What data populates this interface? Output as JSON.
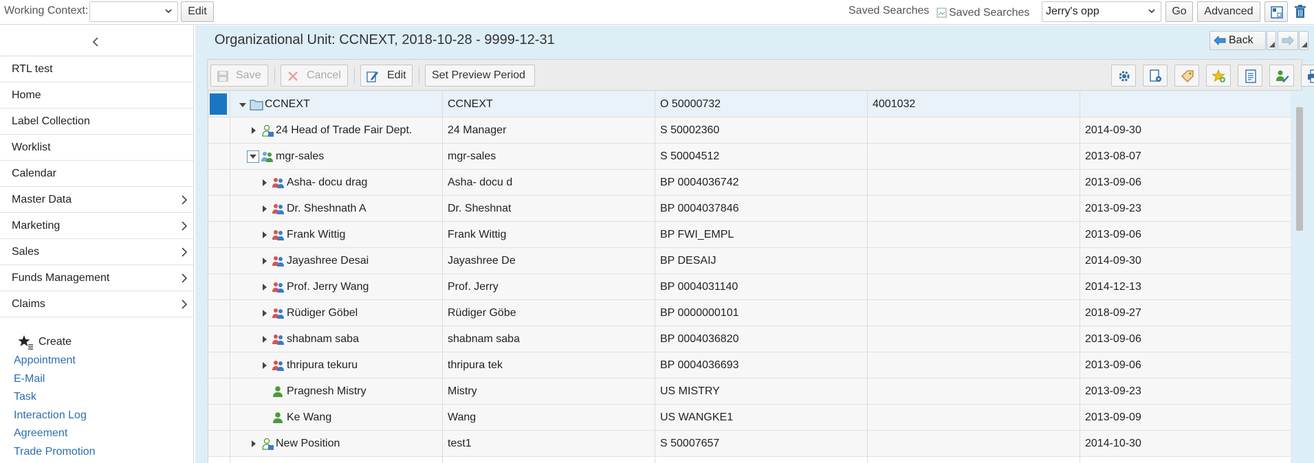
{
  "topbar": {
    "working_context_label": "Working Context:",
    "working_context_value": "",
    "edit_label": "Edit",
    "saved_searches_label": "Saved Searches",
    "saved_searches_img_alt": "Saved Searches",
    "saved_search_value": "Jerry's opp",
    "go_label": "Go",
    "advanced_label": "Advanced"
  },
  "sidebar": {
    "items": [
      {
        "label": "RTL test",
        "arrow": false
      },
      {
        "label": "Home",
        "arrow": false
      },
      {
        "label": "Label Collection",
        "arrow": false
      },
      {
        "label": "Worklist",
        "arrow": false
      },
      {
        "label": "Calendar",
        "arrow": false
      },
      {
        "label": "Master Data",
        "arrow": true
      },
      {
        "label": "Marketing",
        "arrow": true
      },
      {
        "label": "Sales",
        "arrow": true
      },
      {
        "label": "Funds Management",
        "arrow": true
      },
      {
        "label": "Claims",
        "arrow": true
      }
    ],
    "create_label": "Create",
    "create_links": [
      "Appointment",
      "E-Mail",
      "Task",
      "Interaction Log",
      "Agreement",
      "Trade Promotion"
    ]
  },
  "main": {
    "title": "Organizational Unit: CCNEXT, 2018-10-28 - 9999-12-31",
    "back_label": "Back",
    "toolbar": {
      "save_label": "Save",
      "cancel_label": "Cancel",
      "edit_label": "Edit",
      "preview_label": "Set Preview Period"
    }
  },
  "table": {
    "rows": [
      {
        "c1": "CCNEXT",
        "c2": "CCNEXT",
        "c3": "O 50000732",
        "c4": "4001032",
        "c5": "",
        "level": 0,
        "icon": "folder",
        "expander": "open",
        "selected": true
      },
      {
        "c1": "24 Head of Trade Fair Dept.",
        "c2": "24 Manager",
        "c3": "S 50002360",
        "c4": "",
        "c5": "2014-09-30",
        "level": 1,
        "icon": "position",
        "expander": "closed"
      },
      {
        "c1": "mgr-sales",
        "c2": "mgr-sales",
        "c3": "S 50004512",
        "c4": "",
        "c5": "2013-08-07",
        "level": 1,
        "icon": "position-group",
        "expander": "boxed-open"
      },
      {
        "c1": "Asha- docu drag",
        "c2": "Asha- docu d",
        "c3": "BP 0004036742",
        "c4": "",
        "c5": "2013-09-06",
        "level": 2,
        "icon": "people",
        "expander": "closed"
      },
      {
        "c1": "Dr. Sheshnath A",
        "c2": "Dr. Sheshnat",
        "c3": "BP 0004037846",
        "c4": "",
        "c5": "2013-09-23",
        "level": 2,
        "icon": "people",
        "expander": "closed"
      },
      {
        "c1": "Frank Wittig",
        "c2": "Frank Wittig",
        "c3": "BP FWI_EMPL",
        "c4": "",
        "c5": "2013-09-06",
        "level": 2,
        "icon": "people",
        "expander": "closed"
      },
      {
        "c1": "Jayashree Desai",
        "c2": "Jayashree De",
        "c3": "BP DESAIJ",
        "c4": "",
        "c5": "2014-09-30",
        "level": 2,
        "icon": "people",
        "expander": "closed"
      },
      {
        "c1": "Prof. Jerry Wang",
        "c2": "Prof. Jerry",
        "c3": "BP 0004031140",
        "c4": "",
        "c5": "2014-12-13",
        "level": 2,
        "icon": "people",
        "expander": "closed"
      },
      {
        "c1": "Rüdiger Göbel",
        "c2": "Rüdiger Göbe",
        "c3": "BP 0000000101",
        "c4": "",
        "c5": "2018-09-27",
        "level": 2,
        "icon": "people",
        "expander": "closed"
      },
      {
        "c1": "shabnam saba",
        "c2": "shabnam saba",
        "c3": "BP 0004036820",
        "c4": "",
        "c5": "2013-09-06",
        "level": 2,
        "icon": "people",
        "expander": "closed"
      },
      {
        "c1": "thripura tekuru",
        "c2": "thripura tek",
        "c3": "BP 0004036693",
        "c4": "",
        "c5": "2013-09-06",
        "level": 2,
        "icon": "people",
        "expander": "closed"
      },
      {
        "c1": "Pragnesh Mistry",
        "c2": "Mistry",
        "c3": "US MISTRY",
        "c4": "",
        "c5": "2013-09-23",
        "level": 2,
        "icon": "user",
        "expander": "none"
      },
      {
        "c1": "Ke Wang",
        "c2": "Wang",
        "c3": "US WANGKE1",
        "c4": "",
        "c5": "2013-09-09",
        "level": 2,
        "icon": "user",
        "expander": "none"
      },
      {
        "c1": "New Position",
        "c2": "test1",
        "c3": "S 50007657",
        "c4": "",
        "c5": "2014-10-30",
        "level": 1,
        "icon": "position",
        "expander": "closed"
      }
    ]
  },
  "colors": {
    "accent": "#1a76c2",
    "link": "#2a6fb0",
    "main_bg": "#ddeef6"
  }
}
